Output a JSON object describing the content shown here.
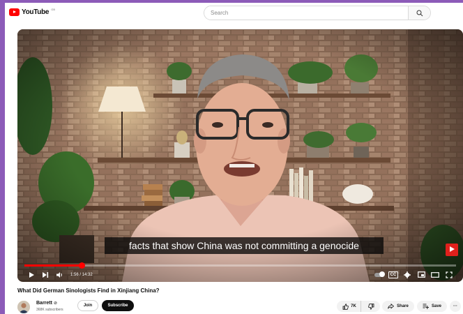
{
  "header": {
    "logo_text": "YouTube",
    "logo_superscript": "GB",
    "search_placeholder": "Search"
  },
  "player": {
    "caption": "facts that show China was not committing a genocide",
    "time_display": "1:56 / 14:32",
    "progress_fraction": 0.133,
    "cc_label": "CC",
    "badge_label": "Subscribe"
  },
  "video": {
    "title": "What Did German Sinologists Find in Xinjiang China?"
  },
  "channel": {
    "name": "Barrett",
    "verified_mark": "⊘",
    "subscribers": "368K subscribers",
    "join_label": "Join",
    "subscribe_label": "Subscribe"
  },
  "actions": {
    "likes": "7K",
    "share_label": "Share",
    "save_label": "Save",
    "more_label": "···"
  },
  "colors": {
    "accent": "#ff0000",
    "frame": "#8c5bb8"
  }
}
